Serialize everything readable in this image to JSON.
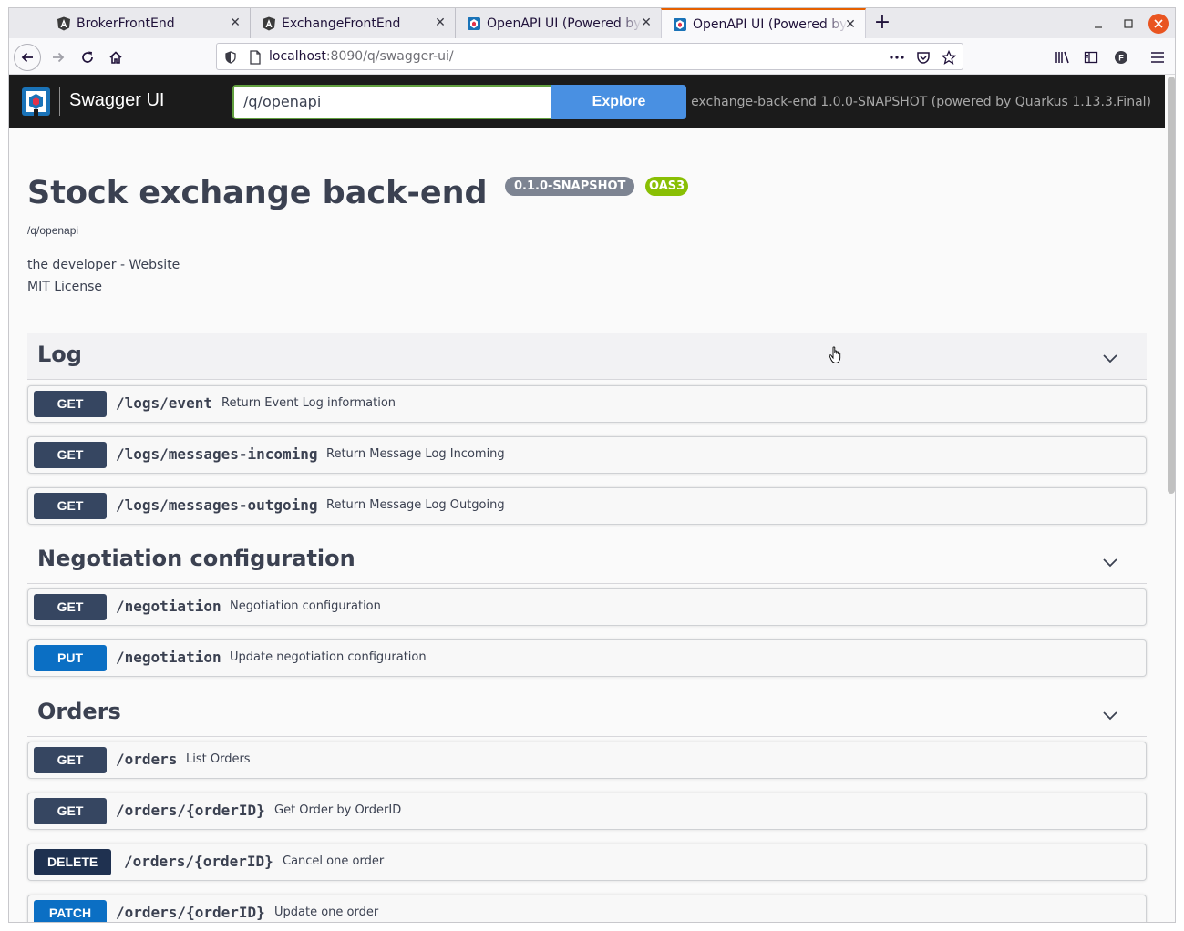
{
  "browser": {
    "tabs": [
      {
        "title": "BrokerFrontEnd",
        "icon": "angular-icon"
      },
      {
        "title": "ExchangeFrontEnd",
        "icon": "angular-icon"
      },
      {
        "title": "OpenAPI UI (Powered by",
        "icon": "quarkus-icon"
      },
      {
        "title": "OpenAPI UI (Powered by",
        "icon": "quarkus-icon"
      }
    ],
    "url_host": "localhost",
    "url_rest": ":8090/q/swagger-ui/",
    "accent_color": "#e66000"
  },
  "swagger": {
    "brand": "Swagger UI",
    "spec_url": "/q/openapi",
    "explore_label": "Explore",
    "powered_by": "exchange-back-end 1.0.0-SNAPSHOT (powered by Quarkus 1.13.3.Final)"
  },
  "info": {
    "title": "Stock exchange back-end",
    "version_badge": "0.1.0-SNAPSHOT",
    "oas_badge": "OAS3",
    "spec_link": "/q/openapi",
    "contact": "the developer - Website",
    "license": "MIT License"
  },
  "colors": {
    "get": "#364661",
    "put": "#0b6fc4",
    "delete": "#1f3150",
    "patch": "#0b6fc4"
  },
  "tags": [
    {
      "name": "Log",
      "operations": [
        {
          "method": "GET",
          "path": "/logs/event",
          "summary": "Return Event Log information"
        },
        {
          "method": "GET",
          "path": "/logs/messages-incoming",
          "summary": "Return Message Log Incoming"
        },
        {
          "method": "GET",
          "path": "/logs/messages-outgoing",
          "summary": "Return Message Log Outgoing"
        }
      ]
    },
    {
      "name": "Negotiation configuration",
      "operations": [
        {
          "method": "GET",
          "path": "/negotiation",
          "summary": "Negotiation configuration"
        },
        {
          "method": "PUT",
          "path": "/negotiation",
          "summary": "Update negotiation configuration"
        }
      ]
    },
    {
      "name": "Orders",
      "operations": [
        {
          "method": "GET",
          "path": "/orders",
          "summary": "List Orders"
        },
        {
          "method": "GET",
          "path": "/orders/{orderID}",
          "summary": "Get Order by OrderID"
        },
        {
          "method": "DELETE",
          "path": "/orders/{orderID}",
          "summary": "Cancel one order"
        },
        {
          "method": "PATCH",
          "path": "/orders/{orderID}",
          "summary": "Update one order"
        }
      ]
    }
  ]
}
